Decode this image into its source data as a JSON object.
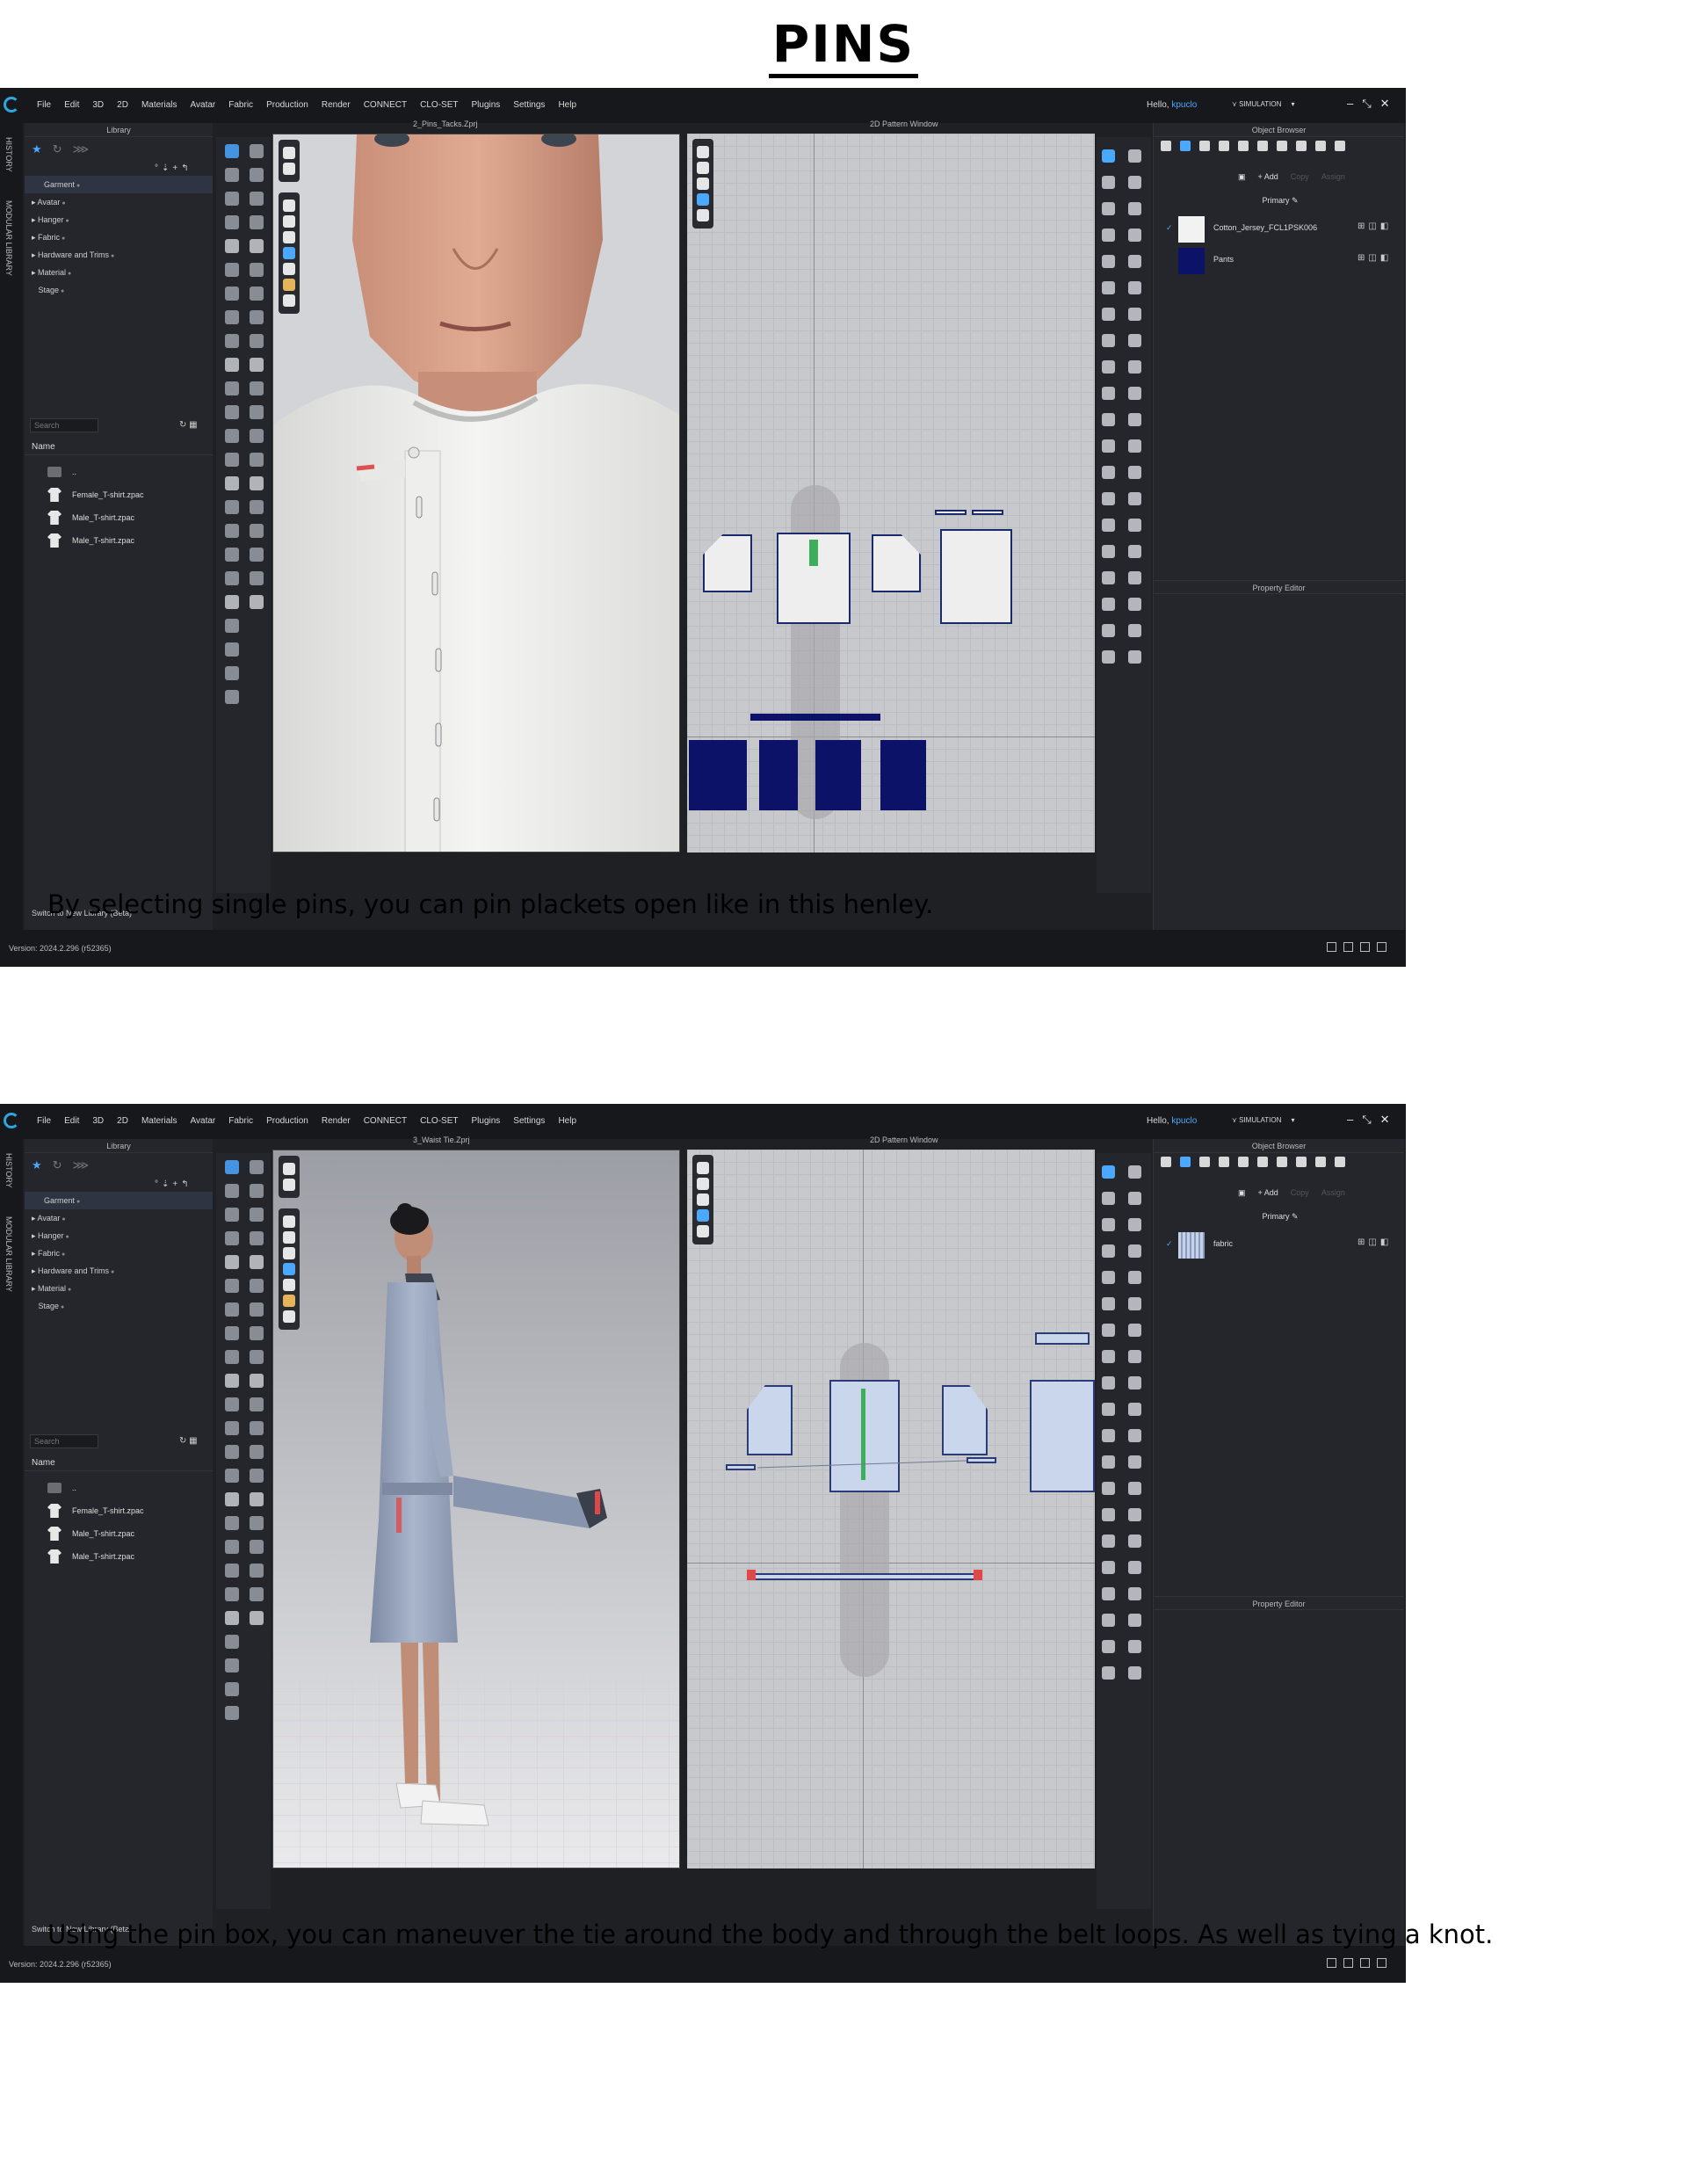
{
  "page": {
    "title": "PINS",
    "caption1": "By selecting single pins, you can pin plackets open like in this henley.",
    "caption2": "Using the pin box, you can maneuver the tie around the body and through the belt loops. As well as tying a knot."
  },
  "app": {
    "menu": [
      "File",
      "Edit",
      "3D",
      "2D",
      "Materials",
      "Avatar",
      "Fabric",
      "Production",
      "Render",
      "CONNECT",
      "CLO-SET",
      "Plugins",
      "Settings",
      "Help"
    ],
    "hello_prefix": "Hello,",
    "user": "kpuclo",
    "mode": "SIMULATION",
    "side_tabs": [
      "HISTORY",
      "MODULAR LIBRARY"
    ],
    "library_title": "Library",
    "tree": [
      "Garment",
      "Avatar",
      "Hanger",
      "Fabric",
      "Hardware and Trims",
      "Material",
      "Stage"
    ],
    "search_placeholder": "Search",
    "list_header": "Name",
    "files": [
      "..",
      "Female_T-shirt.zpac",
      "Male_T-shirt.zpac",
      "Male_T-shirt.zpac"
    ],
    "switch_library": "Switch to New Library (Beta)",
    "pattern_title": "2D Pattern Window",
    "object_browser_title": "Object Browser",
    "add_label": "+ Add",
    "copy_label": "Copy",
    "assign_label": "Assign",
    "primary_label": "Primary",
    "property_editor_title": "Property Editor",
    "version": "Version: 2024.2.296 (r52365)"
  },
  "screen1": {
    "file_title": "2_Pins_Tacks.Zprj",
    "materials": [
      {
        "name": "Cotton_Jersey_FCL1PSK006",
        "color": "#f2f2f2"
      },
      {
        "name": "Pants",
        "color": "#0b1268"
      }
    ]
  },
  "screen2": {
    "file_title": "3_Waist Tie.Zprj",
    "materials": [
      {
        "name": "fabric",
        "color": "#b9c7e2"
      }
    ]
  },
  "colors": {
    "accent": "#4aa8ff",
    "app_bg": "#1f2024",
    "navy_fabric": "#0b1268"
  }
}
